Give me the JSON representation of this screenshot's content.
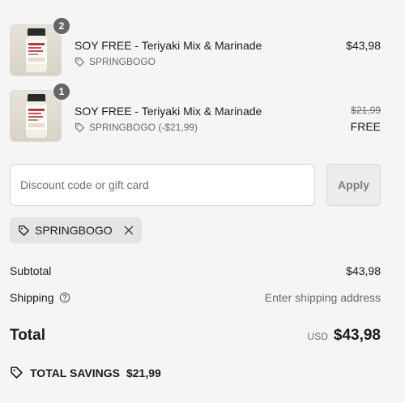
{
  "line_items": [
    {
      "quantity": "2",
      "title": "SOY FREE - Teriyaki Mix & Marinade",
      "discount_label": "SPRINGBOGO",
      "price": "$43,98",
      "thumbnail_icon": "product-jar-image"
    },
    {
      "quantity": "1",
      "title": "SOY FREE - Teriyaki Mix & Marinade",
      "discount_label": "SPRINGBOGO (-$21,99)",
      "original_price": "$21,99",
      "final_price": "FREE",
      "thumbnail_icon": "product-jar-image"
    }
  ],
  "discount": {
    "placeholder": "Discount code or gift card",
    "value": "",
    "apply_label": "Apply",
    "applied_code": "SPRINGBOGO"
  },
  "summary": {
    "subtotal_label": "Subtotal",
    "subtotal_value": "$43,98",
    "shipping_label": "Shipping",
    "shipping_value": "Enter shipping address",
    "total_label": "Total",
    "currency": "USD",
    "total_value": "$43,98",
    "savings_label": "TOTAL SAVINGS",
    "savings_value": "$21,99"
  },
  "colors": {
    "background": "#f5f5f5",
    "badge": "#666666",
    "muted_text": "#6b6b6b",
    "chip_background": "#e4e4e4"
  }
}
